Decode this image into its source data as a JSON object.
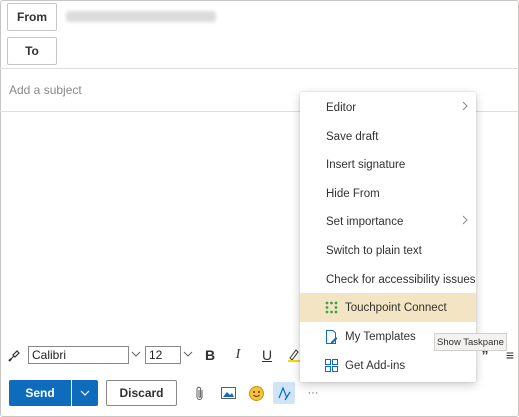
{
  "header": {
    "from_label": "From",
    "to_label": "To",
    "subject_placeholder": "Add a subject"
  },
  "toolbar": {
    "font_name": "Calibri",
    "font_size": "12",
    "bold": "B",
    "italic": "I",
    "underline": "U",
    "quote": "”",
    "more_format": "≡"
  },
  "actions": {
    "send_label": "Send",
    "discard_label": "Discard",
    "more": "···"
  },
  "menu": {
    "items": [
      {
        "label": "Editor",
        "has_submenu": true
      },
      {
        "label": "Save draft"
      },
      {
        "label": "Insert signature"
      },
      {
        "label": "Hide From"
      },
      {
        "label": "Set importance",
        "has_submenu": true
      },
      {
        "label": "Switch to plain text"
      },
      {
        "label": "Check for accessibility issues"
      },
      {
        "label": "Touchpoint Connect",
        "icon": "touchpoint-icon",
        "highlighted": true
      },
      {
        "label": "My Templates",
        "icon": "templates-icon"
      },
      {
        "label": "Get Add-ins",
        "icon": "add-ins-icon"
      }
    ]
  },
  "tooltip": {
    "text": "Show Taskpane"
  },
  "colors": {
    "accent": "#0f6cbd",
    "highlight": "#f3e5c3",
    "touchpoint_green": "#3ea34a"
  }
}
